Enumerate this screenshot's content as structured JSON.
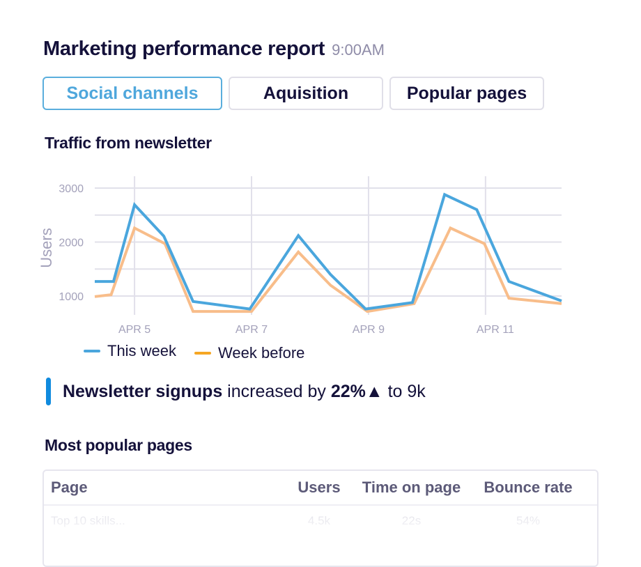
{
  "header": {
    "title": "Marketing performance report",
    "time": "9:00AM"
  },
  "tabs": [
    {
      "label": "Social channels",
      "active": true
    },
    {
      "label": "Aquisition",
      "active": false
    },
    {
      "label": "Popular pages",
      "active": false
    }
  ],
  "chart_section": {
    "title": "Traffic from newsletter"
  },
  "chart_data": {
    "type": "line",
    "title": "Traffic from newsletter",
    "xlabel": "",
    "ylabel": "Users",
    "x_tick_labels": [
      "APR 5",
      "APR 7",
      "APR 9",
      "APR 11"
    ],
    "x_tick_days": [
      5,
      7,
      9,
      11
    ],
    "xlim_days": [
      4.32,
      12.3
    ],
    "ylim": [
      700,
      3000
    ],
    "y_ticks": [
      1000,
      2000,
      3000
    ],
    "grid": true,
    "legend_position": "bottom-left",
    "series": [
      {
        "name": "This week",
        "color": "#4aa6dd",
        "points": [
          [
            4.32,
            1270
          ],
          [
            4.64,
            1270
          ],
          [
            5.0,
            2690
          ],
          [
            5.5,
            2110
          ],
          [
            6.0,
            900
          ],
          [
            6.97,
            760
          ],
          [
            7.8,
            2120
          ],
          [
            8.35,
            1400
          ],
          [
            8.95,
            760
          ],
          [
            9.75,
            880
          ],
          [
            10.3,
            2880
          ],
          [
            10.85,
            2600
          ],
          [
            11.4,
            1270
          ],
          [
            12.3,
            910
          ]
        ]
      },
      {
        "name": "Week before",
        "color": "#f8bd8a",
        "legend_color": "#f5a623",
        "points": [
          [
            4.32,
            990
          ],
          [
            4.6,
            1025
          ],
          [
            5.0,
            2260
          ],
          [
            5.52,
            1970
          ],
          [
            6.0,
            715
          ],
          [
            7.0,
            715
          ],
          [
            7.8,
            1815
          ],
          [
            8.35,
            1200
          ],
          [
            8.98,
            715
          ],
          [
            9.78,
            860
          ],
          [
            10.4,
            2260
          ],
          [
            10.98,
            1970
          ],
          [
            11.4,
            960
          ],
          [
            12.3,
            860
          ]
        ]
      }
    ]
  },
  "legend": {
    "this_week": "This week",
    "week_before": "Week before"
  },
  "callout": {
    "bold_lead": "Newsletter signups",
    "text": " increased by ",
    "value": "22%▲",
    "tail": " to 9k"
  },
  "pages_section": {
    "title": "Most popular pages"
  },
  "table": {
    "columns": [
      "Page",
      "Users",
      "Time on page",
      "Bounce rate"
    ],
    "rows": [
      [
        "Top 10 skills...",
        "4.5k",
        "22s",
        "54%"
      ]
    ]
  }
}
